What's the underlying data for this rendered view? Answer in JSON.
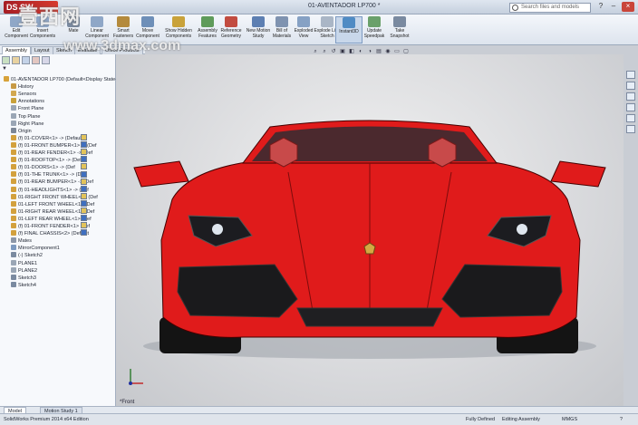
{
  "window": {
    "title": "01-AVENTADOR LP700 *",
    "search_placeholder": "Search files and models",
    "help_glyph": "?",
    "min_glyph": "–",
    "close_glyph": "×"
  },
  "ribbon": [
    {
      "label": "Edit Component",
      "icon_color": "#8fa7c7"
    },
    {
      "label": "Insert Components",
      "icon_color": "#8fa7c7"
    },
    {
      "label": "Mate",
      "icon_color": "#7a8aa0"
    },
    {
      "label": "Linear Component",
      "icon_color": "#8fa7c7"
    },
    {
      "label": "Smart Fasteners",
      "icon_color": "#b48a3c"
    },
    {
      "label": "Move Component",
      "icon_color": "#6e8fb8"
    },
    {
      "label": "Show Hidden Components",
      "icon_color": "#c9a23a"
    },
    {
      "label": "Assembly Features",
      "icon_color": "#5f9b5a"
    },
    {
      "label": "Reference Geometry",
      "icon_color": "#c24c40"
    },
    {
      "label": "New Motion Study",
      "icon_color": "#5d7fb2"
    },
    {
      "label": "Bill of Materials",
      "icon_color": "#7f93b0"
    },
    {
      "label": "Exploded View",
      "icon_color": "#86a1c4"
    },
    {
      "label": "Explode Line Sketch",
      "icon_color": "#aab6c6"
    },
    {
      "label": "Instant3D",
      "icon_color": "#4f8bc4"
    },
    {
      "label": "Update Speedpak",
      "icon_color": "#6aa06a"
    },
    {
      "label": "Take Snapshot",
      "icon_color": "#7a8aa0"
    }
  ],
  "command_tabs": [
    "Assembly",
    "Layout",
    "Sketch",
    "Evaluate",
    "Office Products"
  ],
  "tree": {
    "filter_glyph": "▼",
    "items": [
      {
        "label": "01-AVENTADOR LP700 (Default<Display State-1>)",
        "icon_color": "#d7a23a"
      },
      {
        "label": "History",
        "icon_color": "#c79a45"
      },
      {
        "label": "Sensors",
        "icon_color": "#d2a850"
      },
      {
        "label": "Annotations",
        "icon_color": "#c9a23a"
      },
      {
        "label": "Front Plane",
        "icon_color": "#9aa6b5"
      },
      {
        "label": "Top Plane",
        "icon_color": "#9aa6b5"
      },
      {
        "label": "Right Plane",
        "icon_color": "#9aa6b5"
      },
      {
        "label": "Origin",
        "icon_color": "#7c8797"
      },
      {
        "label": "(f) 01-COVER<1> -> (Default)",
        "icon_color": "#d3a13d"
      },
      {
        "label": "(f) 01-FRONT BUMPER<1> -> (Def",
        "icon_color": "#d3a13d"
      },
      {
        "label": "(f) 01-REAR FENDER<1> -> (Def",
        "icon_color": "#d3a13d"
      },
      {
        "label": "(f) 01-ROOFTOP<1> -> (Def",
        "icon_color": "#d3a13d"
      },
      {
        "label": "(f) 01-DOORS<1> -> (Def",
        "icon_color": "#d3a13d"
      },
      {
        "label": "(f) 01-THE TRUNK<1> -> (Def",
        "icon_color": "#d3a13d"
      },
      {
        "label": "(f) 01-REAR BUMPER<1> -> (Def",
        "icon_color": "#d3a13d"
      },
      {
        "label": "(f) 01-HEADLIGHTS<1> -> (Def",
        "icon_color": "#d3a13d"
      },
      {
        "label": "01-RIGHT FRONT WHEEL<1> (Def",
        "icon_color": "#d3a13d"
      },
      {
        "label": "01-LEFT FRONT WHEEL<1> (Def",
        "icon_color": "#d3a13d"
      },
      {
        "label": "01-RIGHT REAR WHEEL<1> (Def",
        "icon_color": "#d3a13d"
      },
      {
        "label": "01-LEFT REAR WHEEL<1> (Def",
        "icon_color": "#d3a13d"
      },
      {
        "label": "(f) 01-FRONT FENDER<1> (Def",
        "icon_color": "#d3a13d"
      },
      {
        "label": "(f) FINAL CHASSIS<2> (Default",
        "icon_color": "#d3a13d"
      },
      {
        "label": "Mates",
        "icon_color": "#8c97a8"
      },
      {
        "label": "MirrorComponent1",
        "icon_color": "#7d9ac0"
      },
      {
        "label": "(-) Sketch2",
        "icon_color": "#7a8aa0"
      },
      {
        "label": "PLANE1",
        "icon_color": "#9aa6b5"
      },
      {
        "label": "PLANE2",
        "icon_color": "#9aa6b5"
      },
      {
        "label": "Sketch3",
        "icon_color": "#7a8aa0"
      },
      {
        "label": "Sketch4",
        "icon_color": "#7a8aa0"
      }
    ]
  },
  "viewport": {
    "view_label": "*Front",
    "hud_glyphs": [
      "⌕",
      "⌕",
      "↺",
      "▣",
      "◧",
      "◐",
      "◑",
      "▤",
      "◉",
      "▭",
      "▢"
    ],
    "car_body_color": "#e01b1b",
    "car_shadow_color": "#9c0e0e"
  },
  "bottom_tabs": [
    "Model",
    "Motion Study 1"
  ],
  "status": {
    "product": "SolidWorks Premium 2014 x64 Edition",
    "state": "Fully Defined",
    "mode": "Editing Assembly",
    "units": "MMGS",
    "help": "?"
  },
  "watermark": {
    "line1": "壹西网",
    "line2": "www.3dmax.com"
  }
}
